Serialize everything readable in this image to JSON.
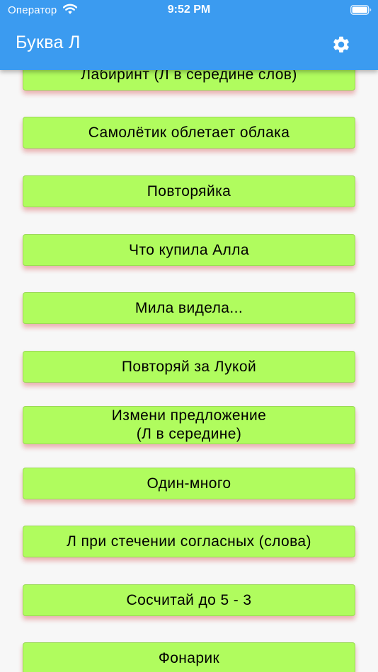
{
  "status_bar": {
    "carrier": "Оператор",
    "time": "9:52 PM",
    "wifi_icon": "wifi-icon",
    "battery_icon": "battery-icon"
  },
  "app_bar": {
    "title": "Буква Л",
    "settings_icon": "gear-icon",
    "background_color": "#3b9bf0"
  },
  "theme": {
    "button_color": "#b0fc5e",
    "button_shadow_color": "#cd1e1e",
    "page_background": "#f7f7f7"
  },
  "exercises": [
    "Лабиринт (Л в середине слов)",
    "Самолётик облетает облака",
    "Повторяйка",
    "Что купила Алла",
    "Мила видела...",
    "Повторяй за Лукой",
    "Измени предложение\n(Л в середине)",
    "Один-много",
    "Л при стечении согласных (слова)",
    "Сосчитай до 5 - 3",
    "Фонарик"
  ]
}
